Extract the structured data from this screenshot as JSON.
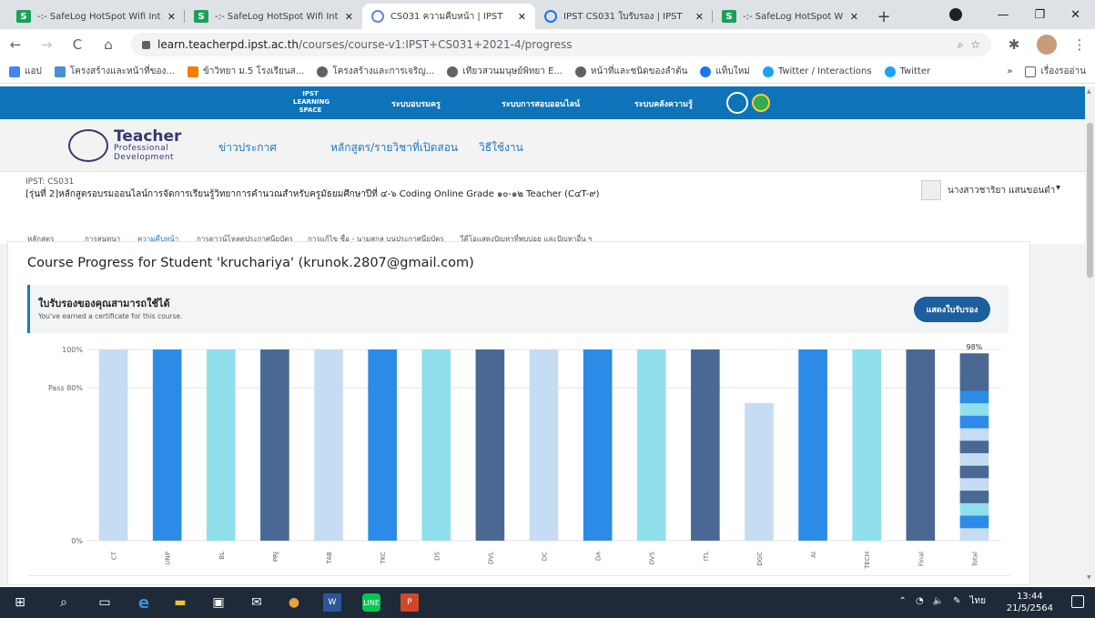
{
  "browser": {
    "tabs": [
      {
        "title": "-:- SafeLog HotSpot Wifi Inte",
        "icon": "safelog-favicon",
        "active": false
      },
      {
        "title": "-:- SafeLog HotSpot Wifi Inte",
        "icon": "safelog-favicon",
        "active": false
      },
      {
        "title": "CS031 ความคืบหน้า | IPST",
        "icon": "ipst-favicon",
        "active": true
      },
      {
        "title": "IPST CS031 ใบรับรอง | IPST",
        "icon": "ring-favicon",
        "active": false
      },
      {
        "title": "-:- SafeLog HotSpot Wifi Inte",
        "icon": "safelog-favicon",
        "active": false
      }
    ],
    "url_host": "learn.teacherpd.ipst.ac.th",
    "url_path": "/courses/course-v1:IPST+CS031+2021-4/progress",
    "bookmarks": [
      {
        "label": "แอป",
        "icon": "apps-icon",
        "color": "#4285f4"
      },
      {
        "label": "โครงสร้างและหน้าที่ของ...",
        "icon": "leaf-icon",
        "color": "#4a8fd4"
      },
      {
        "label": "ข้าวิทยา ม.5 โรงเรียนส...",
        "icon": "blogger-icon",
        "color": "#f57d00"
      },
      {
        "label": "โครงสร้างและการเจริญ...",
        "icon": "globe-icon",
        "color": "#5f6368"
      },
      {
        "label": "เทียวสวนมนุษย์พิทยา E...",
        "icon": "globe-icon",
        "color": "#5f6368"
      },
      {
        "label": "หน้าที่และชนิดของลำต้น",
        "icon": "globe-icon",
        "color": "#5f6368"
      },
      {
        "label": "แท็บใหม่",
        "icon": "facebook-icon",
        "color": "#1877f2"
      },
      {
        "label": "Twitter / Interactions",
        "icon": "twitter-icon",
        "color": "#1da1f2"
      },
      {
        "label": "Twitter",
        "icon": "twitter-icon",
        "color": "#1da1f2"
      }
    ],
    "bookmarks_more": "»",
    "reading_list": "เรื่องรออ่าน"
  },
  "site": {
    "logo_text": "IPST LEARNING SPACE",
    "top_nav": [
      "ระบบอบรมครู",
      "ระบบการสอบออนไลน์",
      "ระบบคลังความรู้"
    ],
    "tpd_logo_main": "Teacher",
    "tpd_logo_sub1": "Professional",
    "tpd_logo_sub2": "Development",
    "main_nav": [
      "ข่าวประกาศ",
      "หลักสูตร/รายวิชาที่เปิดสอน",
      "วิธีใช้งาน"
    ]
  },
  "course": {
    "code": "IPST: CS031",
    "title": "[รุ่นที่ 2]หลักสูตรอบรมออนไลน์การจัดการเรียนรู้วิทยาการคำนวณสำหรับครูมัธยมศึกษาปีที่ ๔-๖ Coding Online Grade ๑๐-๑๒ Teacher (C๔T-๙)",
    "user_name": "นางสาวชาริยา แสนขอนดำ",
    "tabs": [
      "หลักสูตร",
      "การสนทนา",
      "ความคืบหน้า",
      "การดาวน์โหลดประกาศนียบัตร",
      "การแก้ไข ชื่อ - นามสกุล บนประกาศนียบัตร",
      "วีดีโอแสดงปัญหาที่พบบ่อย และปัญหาอื่น ๆ"
    ],
    "active_tab": 2
  },
  "progress": {
    "heading": "Course Progress for Student 'kruchariya' (krunok.2807@gmail.com)",
    "cert_title": "ใบรับรองของคุณสามารถใช้ได้",
    "cert_subtitle": "You've earned a certificate for this course.",
    "cert_button": "แสดงใบรับรอง"
  },
  "chart_data": {
    "type": "bar",
    "categories": [
      "CT",
      "UNP",
      "BL",
      "PRJ",
      "TAB",
      "TKC",
      "DS",
      "DVL",
      "DC",
      "DA",
      "DVS",
      "ITL",
      "DGC",
      "AI",
      "TECH",
      "Final",
      "Total"
    ],
    "values": [
      100,
      100,
      100,
      100,
      100,
      100,
      100,
      100,
      100,
      100,
      100,
      100,
      72,
      100,
      100,
      100,
      98
    ],
    "colors": [
      "#c5dcf2",
      "#2b8be6",
      "#8fe0ec",
      "#4a6894",
      "#c5dcf2",
      "#2b8be6",
      "#8fe0ec",
      "#4a6894",
      "#c5dcf2",
      "#2b8be6",
      "#8fe0ec",
      "#4a6894",
      "#c5dcf2",
      "#2b8be6",
      "#8fe0ec",
      "#4a6894",
      "stacked"
    ],
    "ytick_labels": [
      "100%",
      "Pass 80%",
      "0%"
    ],
    "total_label": "98%",
    "pass_line": 80,
    "ylim": [
      0,
      100
    ]
  },
  "taskbar": {
    "time": "13:44",
    "date": "21/5/2564",
    "lang": "ไทย"
  }
}
